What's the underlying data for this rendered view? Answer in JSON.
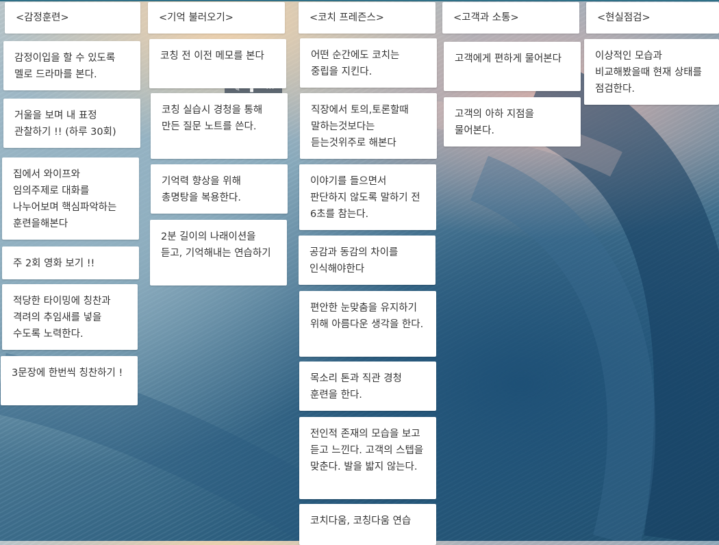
{
  "columns": [
    {
      "title": "<감정훈련>",
      "cards": [
        "감정이입을 할 수 있도록 멜로 드라마를 본다.",
        "거울을 보며 내 표정 관찰하기 !! (하루 30회)",
        "집에서 와이프와 임의주제로 대화를 나누어보며 핵심파악하는 훈련을해본다",
        "주 2회 영화 보기 !!",
        "적당한 타이밍에 칭찬과 격려의 추임새를 넣을 수도록 노력한다.",
        "3문장에 한번씩 칭찬하기 !"
      ]
    },
    {
      "title": "<기억 불러오기>",
      "cards": [
        "코칭 전 이전 메모를 본다",
        "코칭 실습시 경청을 통해 만든 질문 노트를 쓴다.",
        "기억력 향상을 위해 총명탕을 복용한다.",
        "2분 길이의 나래이션을 듣고, 기억해내는 연습하기"
      ]
    },
    {
      "title": "<코치 프레즌스>",
      "cards": [
        "어떤 순간에도 코치는 중립을 지킨다.",
        "직장에서 토의,토론할때 말하는것보다는 듣는것위주로 해본다",
        "이야기를 들으면서 판단하지 않도록 말하기 전 6초를 참는다.",
        "공감과 동감의 차이를 인식해야한다",
        "편안한 눈맞춤을 유지하기 위해 아름다운 생각을 한다.",
        "목소리 톤과 직관 경청 훈련을 한다.",
        "전인적 존재의 모습을 보고 듣고 느낀다. 고객의 스텝을 맞춘다. 발을 밟지 않는다.",
        "코치다움, 코칭다움 연습"
      ]
    },
    {
      "title": "<고객과 소통>",
      "cards": [
        "고객에게 편하게 물어본다",
        "고객의 아하 지점을 물어본다."
      ]
    },
    {
      "title": "<현실점검>",
      "cards": [
        "이상적인 모습과 비교해봤을때 현재 상태를 점검한다."
      ]
    }
  ]
}
